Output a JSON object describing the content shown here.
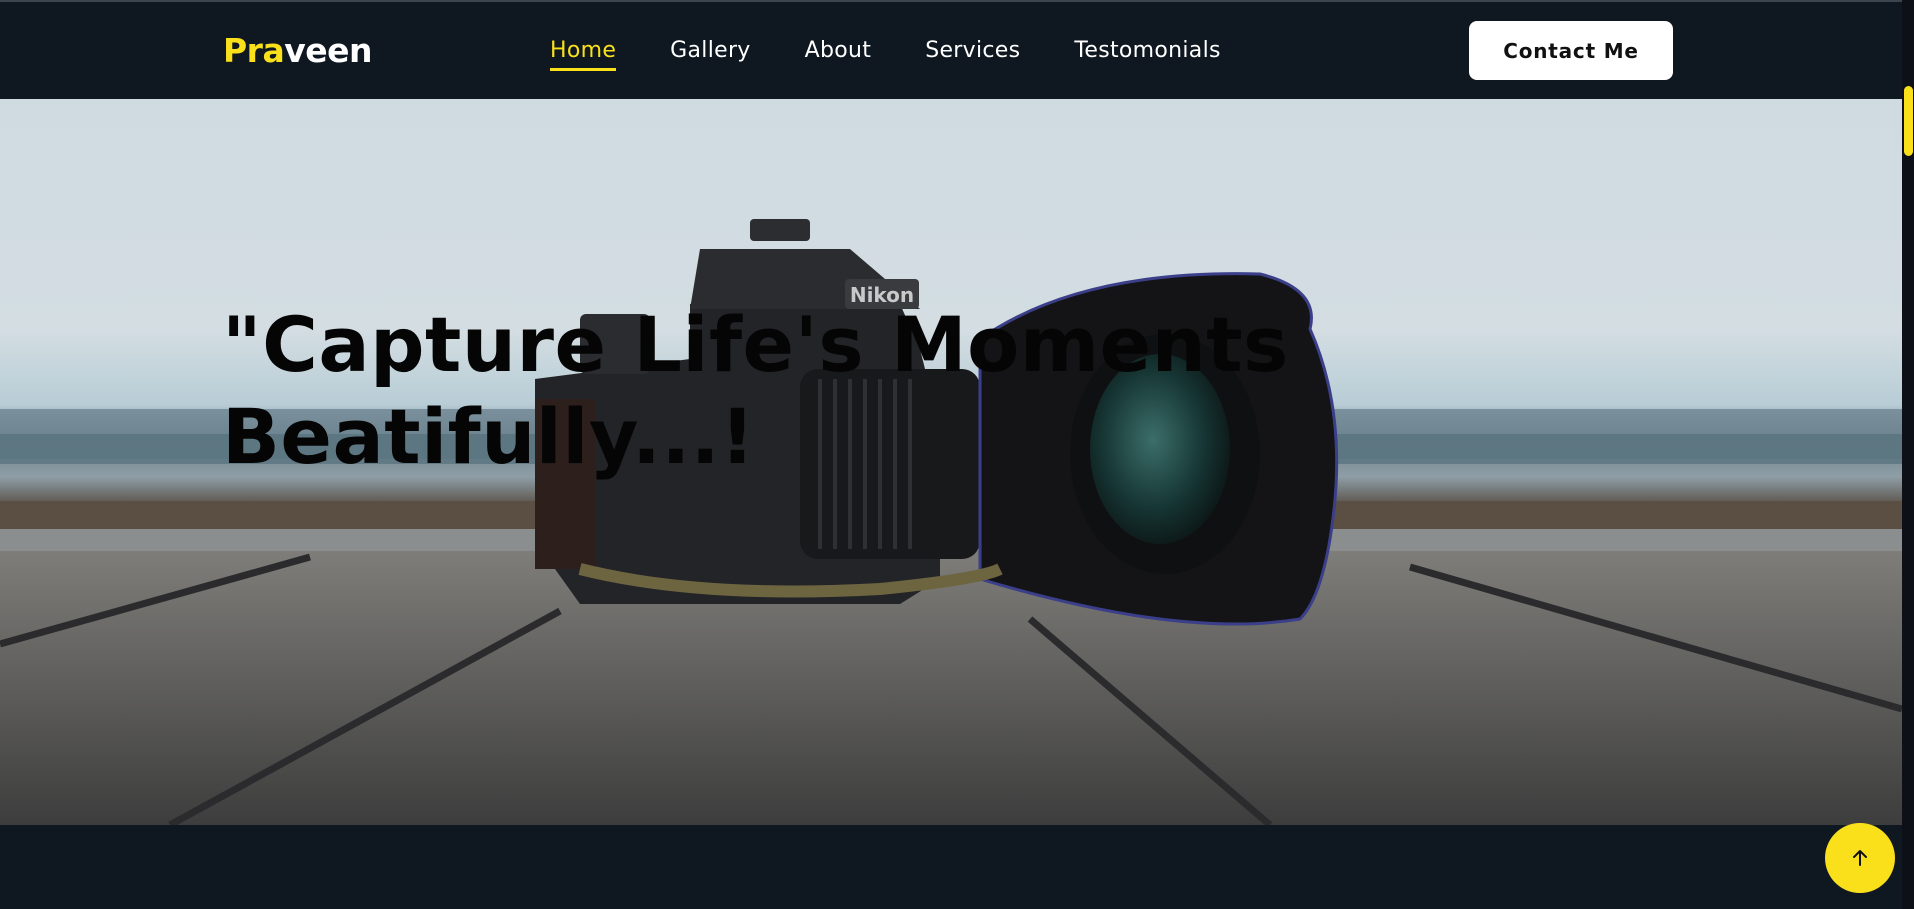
{
  "brand": {
    "logo_accent": "Pra",
    "logo_rest": "veen",
    "accent_color": "#f9e01b"
  },
  "nav": {
    "items": [
      {
        "label": "Home",
        "active": true
      },
      {
        "label": "Gallery"
      },
      {
        "label": "About"
      },
      {
        "label": "Services"
      },
      {
        "label": "Testomonials"
      }
    ],
    "contact_label": "Contact Me"
  },
  "hero": {
    "title_line1": "\"Capture Life's Moments",
    "title_line2": "Beatifully...!",
    "camera_brand": "Nikon"
  },
  "icons": {
    "back_to_top": "arrow-up-icon"
  }
}
